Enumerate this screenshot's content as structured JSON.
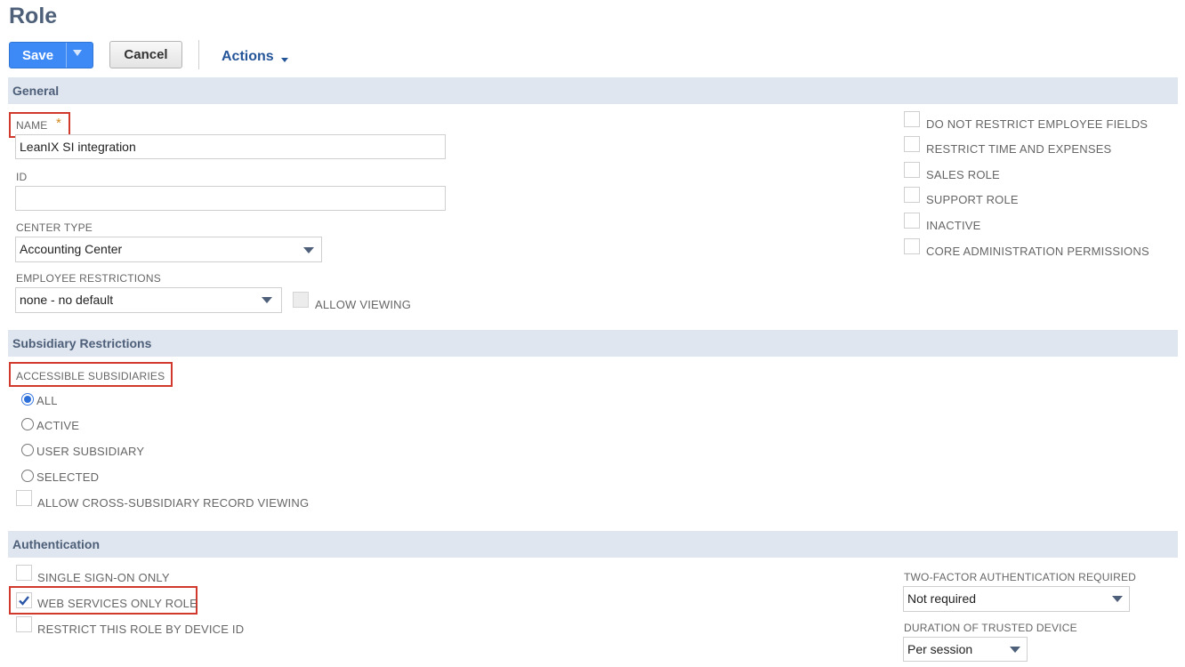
{
  "page": {
    "title": "Role"
  },
  "toolbar": {
    "save_label": "Save",
    "cancel_label": "Cancel",
    "actions_label": "Actions"
  },
  "general": {
    "header": "General",
    "name_label": "NAME",
    "name_required": "*",
    "name_value": "LeanIX SI integration",
    "id_label": "ID",
    "id_value": "",
    "center_type_label": "CENTER TYPE",
    "center_type_value": "Accounting Center",
    "employee_restrictions_label": "EMPLOYEE RESTRICTIONS",
    "employee_restrictions_value": "none - no default",
    "allow_viewing_label": "ALLOW VIEWING",
    "checkboxes": [
      {
        "label": "DO NOT RESTRICT EMPLOYEE FIELDS",
        "checked": false
      },
      {
        "label": "RESTRICT TIME AND EXPENSES",
        "checked": false
      },
      {
        "label": "SALES ROLE",
        "checked": false
      },
      {
        "label": "SUPPORT ROLE",
        "checked": false
      },
      {
        "label": "INACTIVE",
        "checked": false
      },
      {
        "label": "CORE ADMINISTRATION PERMISSIONS",
        "checked": false
      }
    ]
  },
  "subsidiary": {
    "header": "Subsidiary Restrictions",
    "accessible_label": "ACCESSIBLE SUBSIDIARIES",
    "options": [
      {
        "label": "ALL",
        "selected": true
      },
      {
        "label": "ACTIVE",
        "selected": false
      },
      {
        "label": "USER SUBSIDIARY",
        "selected": false
      },
      {
        "label": "SELECTED",
        "selected": false
      }
    ],
    "cross_subsidiary_label": "ALLOW CROSS-SUBSIDIARY RECORD VIEWING"
  },
  "authentication": {
    "header": "Authentication",
    "sso_label": "SINGLE SIGN-ON ONLY",
    "web_services_label": "WEB SERVICES ONLY ROLE",
    "web_services_checked": true,
    "device_id_label": "RESTRICT THIS ROLE BY DEVICE ID",
    "two_factor_label": "TWO-FACTOR AUTHENTICATION REQUIRED",
    "two_factor_value": "Not required",
    "trusted_device_label": "DURATION OF TRUSTED DEVICE",
    "trusted_device_value": "Per session"
  },
  "colors": {
    "accent": "#3d8af7",
    "section_bg": "#e0e6ef",
    "header_text": "#4d5f79",
    "highlight": "#d1392d"
  }
}
